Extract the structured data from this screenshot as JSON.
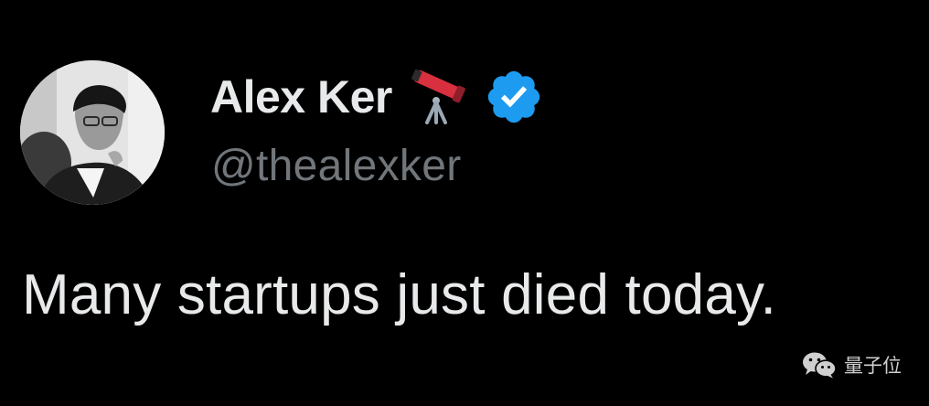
{
  "tweet": {
    "author": {
      "display_name": "Alex Ker",
      "handle": "@thealexker",
      "name_emoji": "telescope-icon",
      "verified_badge": "verified-badge-icon"
    },
    "text": "Many startups just died today."
  },
  "watermark": {
    "label": "量子位",
    "icon": "wechat-icon"
  },
  "colors": {
    "background": "#000000",
    "primary_text": "#e7e9ea",
    "secondary_text": "#71767b",
    "verified_blue": "#1d9bf0"
  }
}
